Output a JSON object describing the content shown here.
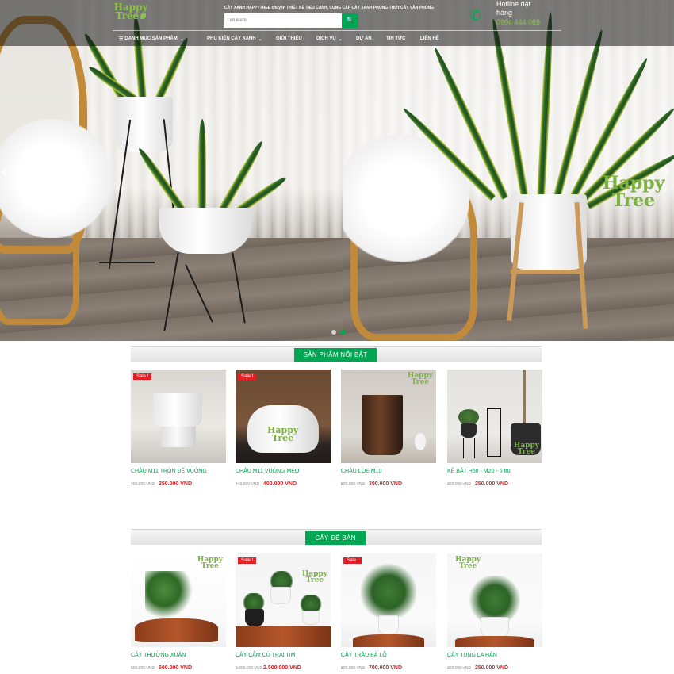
{
  "header": {
    "logo_text": "Happy Tree",
    "tagline": "CÂY XANH HAPPYTREE chuyên THIẾT KẾ TIỂU CẢNH, CUNG CẤP CÂY XANH PHONG THỦY,CÂY VĂN PHÒNG",
    "search_placeholder": "Tìm kiếm",
    "search_button_icon": "search-icon",
    "hotline_label": "Hotline đặt hàng",
    "hotline_number": "0904 444 069",
    "nav": [
      {
        "label": "DANH MỤC SẢN PHẨM",
        "has_menu_icon": true,
        "has_caret": true
      },
      {
        "label": "PHỤ KIỆN CÂY XANH",
        "has_caret": true
      },
      {
        "label": "GIỚI THIỆU",
        "has_caret": false
      },
      {
        "label": "DỊCH VỤ",
        "has_caret": true
      },
      {
        "label": "DỰ ÁN",
        "has_caret": false
      },
      {
        "label": "TIN TỨC",
        "has_caret": false
      },
      {
        "label": "LIÊN HỆ",
        "has_caret": false
      }
    ]
  },
  "hero": {
    "watermark": "Happy Tree",
    "slides_count": 2,
    "active_slide": 2
  },
  "sections": [
    {
      "title": "SẢN PHẨM NỔI BẬT",
      "products": [
        {
          "name": "CHẬU M11 TRÒN ĐẾ VUÔNG",
          "old_price": "400.000 VND",
          "price": "250.000 VND",
          "sale": "Sale !"
        },
        {
          "name": "CHẬU M11 VUÔNG MÉO",
          "old_price": "440.000 VND",
          "price": "400.000 VND",
          "sale": "Sale !"
        },
        {
          "name": "CHẬU LOE M10",
          "old_price": "500.000 VND",
          "price": "300.000 VND",
          "sale": ""
        },
        {
          "name": "KỆ BẮT H50 - M20 - 6 trụ",
          "old_price": "300.000 VND",
          "price": "250.000 VND",
          "sale": ""
        }
      ]
    },
    {
      "title": "CÂY ĐỂ BÀN",
      "products": [
        {
          "name": "CÂY THƯỜNG XUÂN",
          "old_price": "800.000 VND",
          "price": "600.000 VND",
          "sale": ""
        },
        {
          "name": "CÂY CẨM CÙ TRÁI TIM",
          "old_price": "3.000.000 VND",
          "price": "2.500.000 VND",
          "sale": "Sale !"
        },
        {
          "name": "CÂY TRẦU BÀ LỖ",
          "old_price": "800.000 VND",
          "price": "700.000 VND",
          "sale": "Sale !"
        },
        {
          "name": "CÂY TÙNG LA HÁN",
          "old_price": "300.000 VND",
          "price": "250.000 VND",
          "sale": ""
        }
      ]
    }
  ],
  "colors": {
    "brand_green": "#00a651",
    "logo_green": "#8bc34a",
    "sale_red": "#e31e24"
  }
}
